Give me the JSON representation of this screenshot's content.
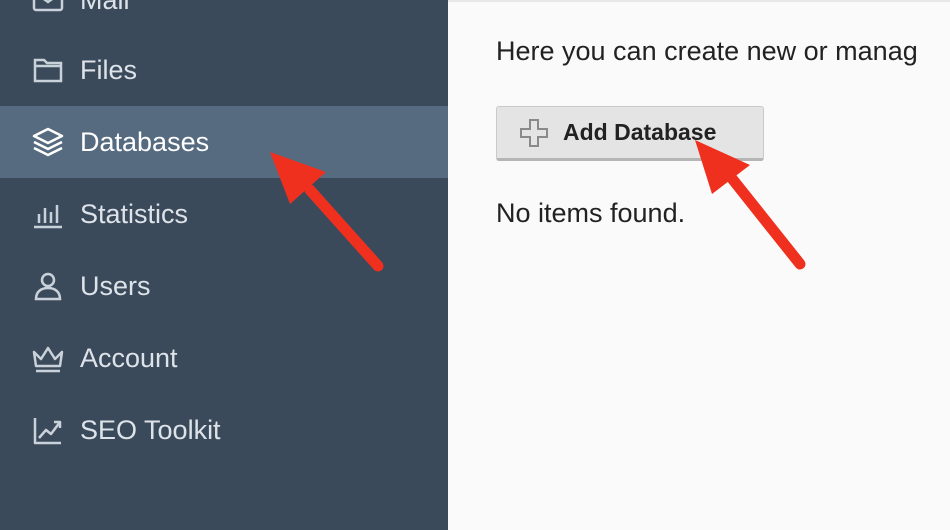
{
  "sidebar": {
    "items": [
      {
        "label": "Mail",
        "icon": "mail-icon"
      },
      {
        "label": "Files",
        "icon": "folder-icon"
      },
      {
        "label": "Databases",
        "icon": "layers-icon",
        "active": true
      },
      {
        "label": "Statistics",
        "icon": "bar-chart-icon"
      },
      {
        "label": "Users",
        "icon": "user-icon"
      },
      {
        "label": "Account",
        "icon": "crown-icon"
      },
      {
        "label": "SEO Toolkit",
        "icon": "trend-chart-icon"
      }
    ]
  },
  "main": {
    "intro_text": "Here you can create new or manag",
    "add_button_label": "Add Database",
    "empty_text": "No items found."
  },
  "colors": {
    "sidebar_bg": "#3b4a5a",
    "sidebar_active_bg": "#566b80",
    "annotation_arrow": "#f0301e"
  }
}
